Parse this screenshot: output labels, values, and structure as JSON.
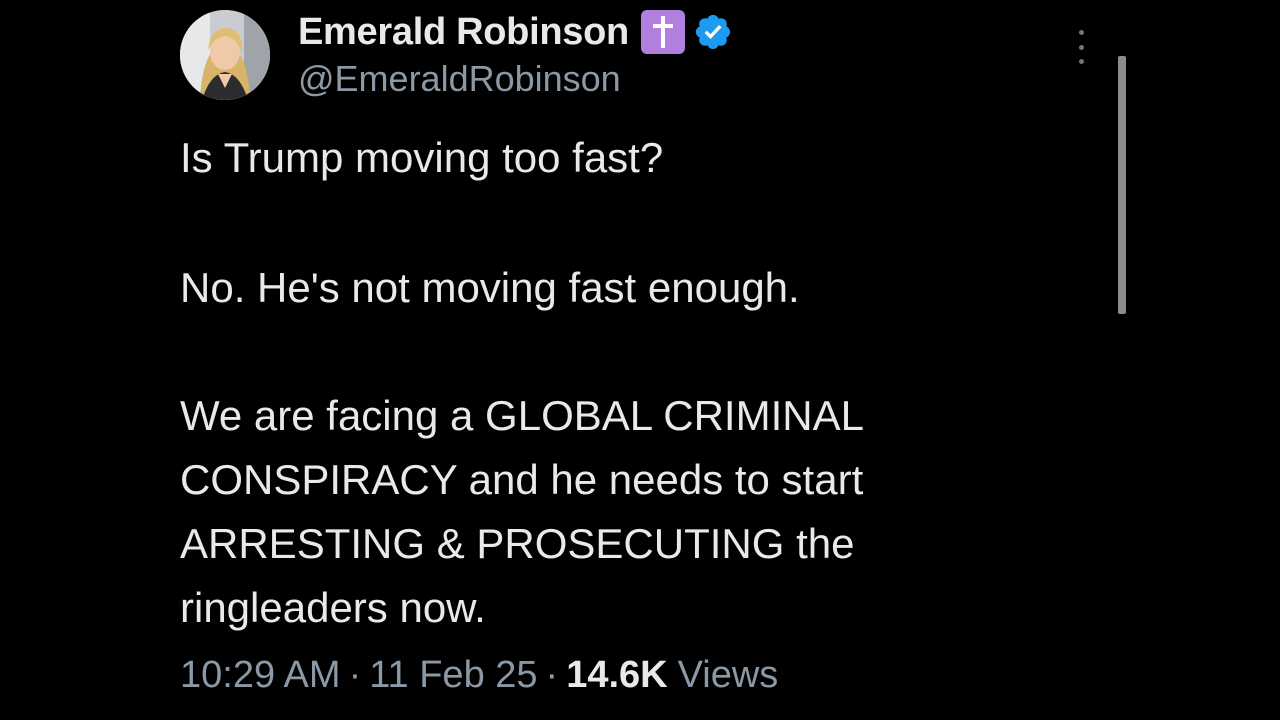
{
  "author": {
    "display_name": "Emerald Robinson",
    "handle": "@EmeraldRobinson",
    "badges": [
      "latin-cross-icon",
      "verified-badge-icon"
    ],
    "avatar": "profile-photo"
  },
  "tweet": {
    "paragraphs": [
      "Is Trump moving too fast?",
      "No. He's not moving fast enough.",
      "We are facing a GLOBAL CRIMINAL",
      "CONSPIRACY and he needs to start",
      "ARRESTING & PROSECUTING the",
      "ringleaders now."
    ]
  },
  "meta": {
    "time": "10:29 AM",
    "date": "11 Feb 25",
    "separator": "·",
    "views_count": "14.6K",
    "views_label": "Views"
  },
  "colors": {
    "background": "#000000",
    "text": "#e7e9ea",
    "secondary": "#8b98a5",
    "verified": "#1d9bf0",
    "cross_badge": "#b07fe0"
  }
}
